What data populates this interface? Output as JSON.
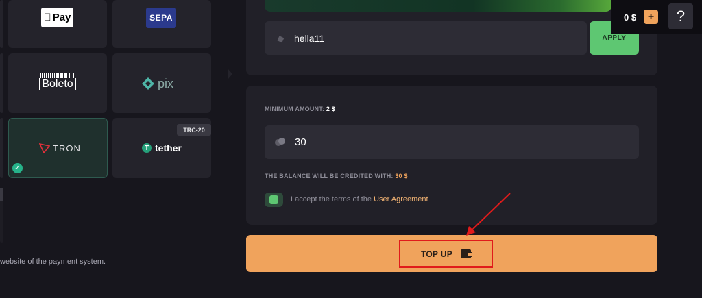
{
  "payment_methods": {
    "applepay": {
      "label": "Pay"
    },
    "sepa": {
      "label": "SEPA"
    },
    "boleto": {
      "label": "Boleto"
    },
    "pix": {
      "label": "pix"
    },
    "tron": {
      "label": "TRON",
      "selected": true
    },
    "tether": {
      "label": "tether",
      "badge": "TRC-20"
    }
  },
  "redirect_note": "website of the payment system.",
  "promo": {
    "value": "hella11",
    "apply_label": "APPLY"
  },
  "minimum": {
    "label": "MINIMUM AMOUNT:",
    "value": "2 $"
  },
  "amount": {
    "value": "30"
  },
  "credited": {
    "label": "THE BALANCE WILL BE CREDITED WITH:",
    "value": "30 $"
  },
  "agreement": {
    "prefix": "I accept the terms of the",
    "link": "User Agreement",
    "checked": true
  },
  "topup": {
    "label": "TOP UP"
  },
  "header": {
    "balance": "0 $",
    "plus": "+",
    "help": "?"
  },
  "colors": {
    "accent": "#f0a35c",
    "green": "#5ec772",
    "highlight": "#e01b1b"
  }
}
